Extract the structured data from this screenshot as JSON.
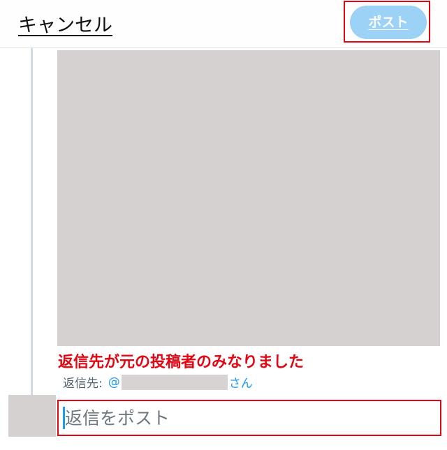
{
  "header": {
    "cancel_label": "キャンセル",
    "post_label": "ポスト"
  },
  "annotation": {
    "text": "返信先が元の投稿者のみなりました",
    "color": "#e30613"
  },
  "reply_to": {
    "label": "返信先:",
    "at": "@",
    "suffix": "さん"
  },
  "composer": {
    "placeholder": "返信をポスト"
  },
  "colors": {
    "accent": "#1d9bf0",
    "post_button_disabled": "#9bd2f5",
    "highlight": "#e30613",
    "placeholder_gray": "#d4d1d0"
  }
}
